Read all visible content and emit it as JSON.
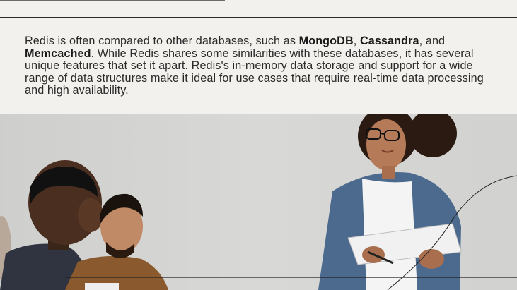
{
  "article": {
    "para_1": "Redis is often compared to other databases, such as ",
    "db_mongodb": "MongoDB",
    "sep_1": ", ",
    "db_cassandra": "Cassandra",
    "sep_2": ", and",
    "db_memcached": "Memcached",
    "para_2": ". While Redis shares some similarities with these databases, it has several unique features that set it apart. Redis's in-memory data storage and support for a wide range of data structures make it ideal for use cases that require real-time data processing and high availability."
  },
  "colors": {
    "background": "#f3f1ed",
    "text": "#2a2a2a",
    "rule": "#2c2c2c"
  },
  "image": {
    "subject": "team-meeting-photo"
  }
}
